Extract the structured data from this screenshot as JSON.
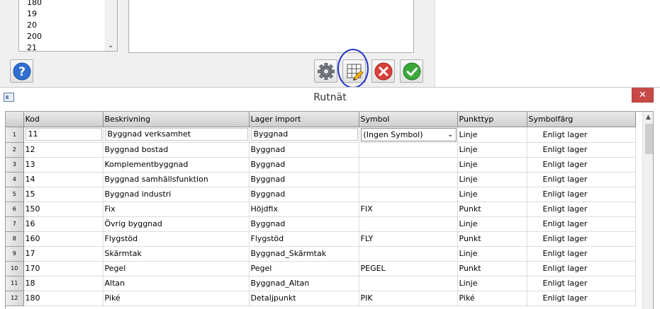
{
  "top_dialog": {
    "list_items": [
      "180",
      "19",
      "20",
      "200",
      "21"
    ]
  },
  "icons": {
    "help": "help-question-icon",
    "settings": "gear-icon",
    "grid": "grid-edit-icon",
    "cancel": "cancel-x-icon",
    "ok": "ok-checkmark-icon"
  },
  "colors": {
    "help_blue": "#2f6fcf",
    "cancel_red": "#d8403a",
    "ok_green": "#3ba83b",
    "annotation_blue": "#2436c8",
    "close_red": "#c74a46"
  },
  "window": {
    "title": "Rutnät",
    "close_label": "✕"
  },
  "grid": {
    "columns": [
      "Kod",
      "Beskrivning",
      "Lager import",
      "Symbol",
      "Punkttyp",
      "Symbolfärg"
    ],
    "rows": [
      {
        "num": "1",
        "kod": "11",
        "beskrivning": "Byggnad verksamhet",
        "lager": "Byggnad",
        "symbol": "(Ingen Symbol)",
        "punkttyp": "Linje",
        "farg": "Enligt lager"
      },
      {
        "num": "2",
        "kod": "12",
        "beskrivning": "Byggnad bostad",
        "lager": "Byggnad",
        "symbol": "",
        "punkttyp": "Linje",
        "farg": "Enligt lager"
      },
      {
        "num": "3",
        "kod": "13",
        "beskrivning": "Komplementbyggnad",
        "lager": "Byggnad",
        "symbol": "",
        "punkttyp": "Linje",
        "farg": "Enligt lager"
      },
      {
        "num": "4",
        "kod": "14",
        "beskrivning": "Byggnad samhällsfunktion",
        "lager": "Byggnad",
        "symbol": "",
        "punkttyp": "Linje",
        "farg": "Enligt lager"
      },
      {
        "num": "5",
        "kod": "15",
        "beskrivning": "Byggnad industri",
        "lager": "Byggnad",
        "symbol": "",
        "punkttyp": "Linje",
        "farg": "Enligt lager"
      },
      {
        "num": "6",
        "kod": "150",
        "beskrivning": "Fix",
        "lager": "Höjdfix",
        "symbol": "FIX",
        "punkttyp": "Punkt",
        "farg": "Enligt lager"
      },
      {
        "num": "7",
        "kod": "16",
        "beskrivning": "Övrig byggnad",
        "lager": "Byggnad",
        "symbol": "",
        "punkttyp": "Linje",
        "farg": "Enligt lager"
      },
      {
        "num": "8",
        "kod": "160",
        "beskrivning": "Flygstöd",
        "lager": "Flygstöd",
        "symbol": "FLY",
        "punkttyp": "Punkt",
        "farg": "Enligt lager"
      },
      {
        "num": "9",
        "kod": "17",
        "beskrivning": "Skärmtak",
        "lager": "Byggnad_Skärmtak",
        "symbol": "",
        "punkttyp": "Linje",
        "farg": "Enligt lager"
      },
      {
        "num": "10",
        "kod": "170",
        "beskrivning": "Pegel",
        "lager": "Pegel",
        "symbol": "PEGEL",
        "punkttyp": "Punkt",
        "farg": "Enligt lager"
      },
      {
        "num": "11",
        "kod": "18",
        "beskrivning": "Altan",
        "lager": "Byggnad_Altan",
        "symbol": "",
        "punkttyp": "Linje",
        "farg": "Enligt lager"
      },
      {
        "num": "12",
        "kod": "180",
        "beskrivning": "Piké",
        "lager": "Detaljpunkt",
        "symbol": "PIK",
        "punkttyp": "Piké",
        "farg": "Enligt lager"
      }
    ]
  }
}
